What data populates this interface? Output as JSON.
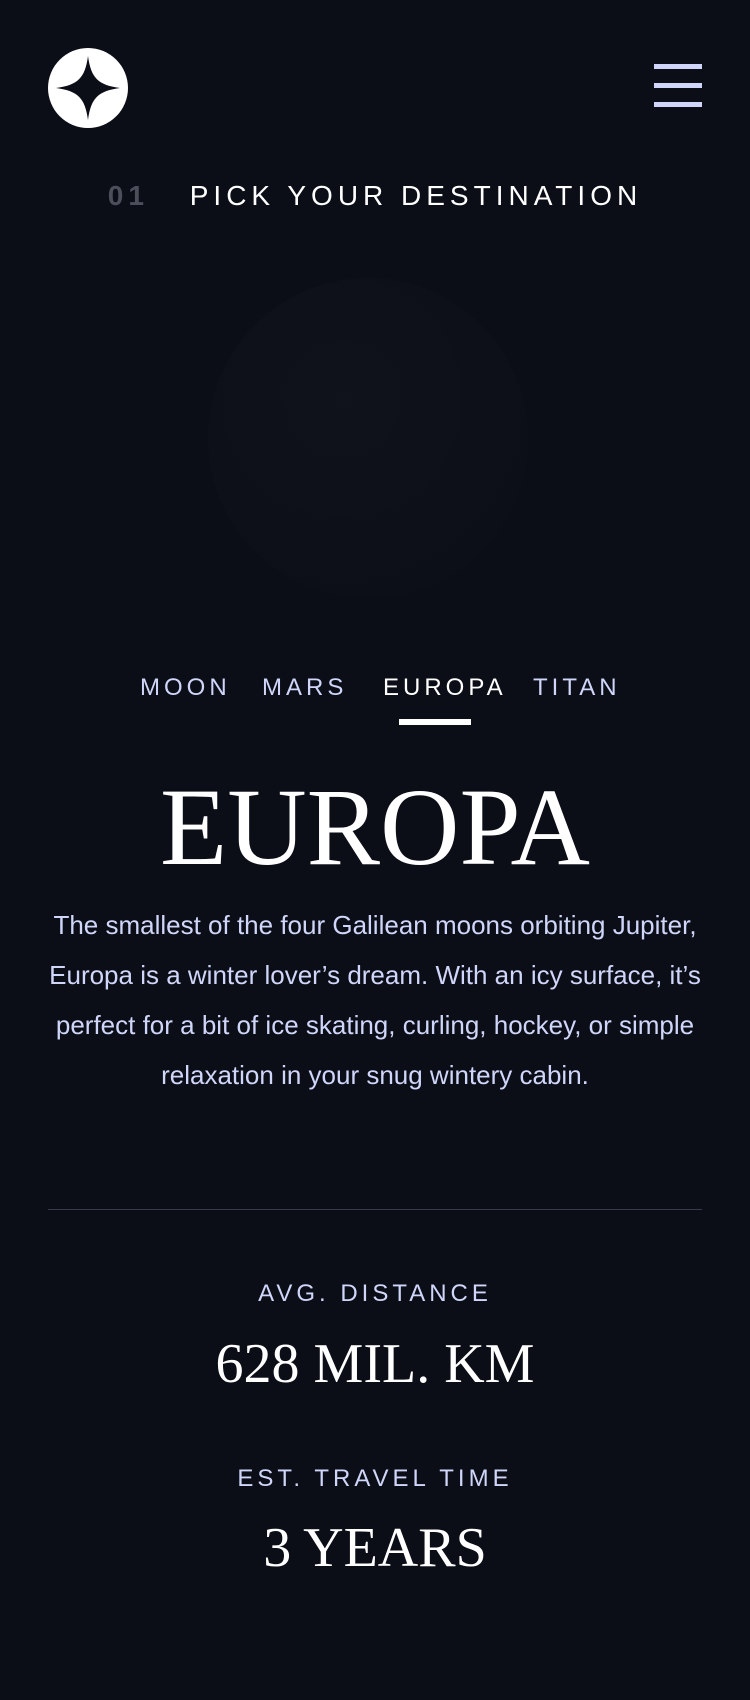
{
  "header": {
    "logo_icon": "star-logo-icon",
    "menu_icon": "hamburger-menu-icon"
  },
  "section": {
    "number": "01",
    "title": "PICK YOUR DESTINATION"
  },
  "tabs": [
    {
      "label": "MOON",
      "active": false
    },
    {
      "label": "MARS",
      "active": false
    },
    {
      "label": "EUROPA",
      "active": true
    },
    {
      "label": "TITAN",
      "active": false
    }
  ],
  "destination": {
    "name": "EUROPA",
    "description": "The smallest of the four Galilean moons orbiting Jupiter, Europa is a winter lover’s dream. With an icy surface, it’s perfect for a bit of ice skating, curling, hockey, or simple relaxation in your snug wintery cabin.",
    "image_icon": "planet-europa-image"
  },
  "stats": {
    "distance_label": "AVG. DISTANCE",
    "distance_value": "628 MIL. KM",
    "travel_label": "EST. TRAVEL TIME",
    "travel_value": "3 YEARS"
  },
  "colors": {
    "background": "#0b0d17",
    "accent": "#d0d6f9",
    "white": "#ffffff",
    "muted": "#4c4f5a"
  }
}
